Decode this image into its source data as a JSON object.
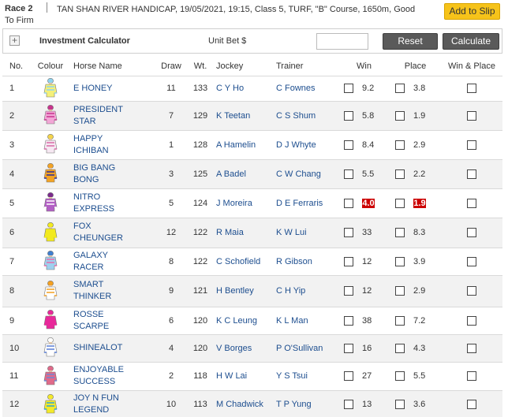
{
  "header": {
    "race_no": "Race 2",
    "race_info": "TAN SHAN RIVER HANDICAP, 19/05/2021, 19:15, Class 5, TURF, \"B\" Course, 1650m, Good To Firm",
    "add_to_slip": "Add to Slip"
  },
  "calculator": {
    "plus": "+",
    "title": "Investment Calculator",
    "unit_bet": "Unit Bet $",
    "input_value": "",
    "reset": "Reset",
    "calculate": "Calculate"
  },
  "columns": {
    "no": "No.",
    "colour": "Colour",
    "horse": "Horse Name",
    "draw": "Draw",
    "wt": "Wt.",
    "jockey": "Jockey",
    "trainer": "Trainer",
    "win": "Win",
    "place": "Place",
    "win_place": "Win & Place"
  },
  "colors": {
    "link": "#1d4e8f",
    "hot_odds": "#cc0000",
    "add_slip": "#f6c31a",
    "dark_button": "#5a5a5a"
  },
  "runners": [
    {
      "no": "1",
      "horse_l1": "E HONEY",
      "horse_l2": "",
      "draw": "11",
      "wt": "133",
      "jockey": "C Y Ho",
      "trainer": "C Fownes",
      "win": "9.2",
      "place": "3.8",
      "win_hot": false,
      "place_hot": false,
      "silk": {
        "body": "#f4f07a",
        "trim": "#8fd3ee",
        "cap": "#8fd3ee"
      }
    },
    {
      "no": "2",
      "horse_l1": "PRESIDENT",
      "horse_l2": "STAR",
      "draw": "7",
      "wt": "129",
      "jockey": "K Teetan",
      "trainer": "C S Shum",
      "win": "5.8",
      "place": "1.9",
      "win_hot": false,
      "place_hot": false,
      "silk": {
        "body": "#f2a6d6",
        "trim": "#c8338d",
        "cap": "#c8338d"
      }
    },
    {
      "no": "3",
      "horse_l1": "HAPPY",
      "horse_l2": "ICHIBAN",
      "draw": "1",
      "wt": "128",
      "jockey": "A Hamelin",
      "trainer": "D J Whyte",
      "win": "8.4",
      "place": "2.9",
      "win_hot": false,
      "place_hot": false,
      "silk": {
        "body": "#f6e8f2",
        "trim": "#d96aa8",
        "cap": "#f4d44a"
      }
    },
    {
      "no": "4",
      "horse_l1": "BIG BANG",
      "horse_l2": "BONG",
      "draw": "3",
      "wt": "125",
      "jockey": "A Badel",
      "trainer": "C W Chang",
      "win": "5.5",
      "place": "2.2",
      "win_hot": false,
      "place_hot": false,
      "silk": {
        "body": "#f3a324",
        "trim": "#2d2d9a",
        "cap": "#f3a324"
      }
    },
    {
      "no": "5",
      "horse_l1": "NITRO",
      "horse_l2": "EXPRESS",
      "draw": "5",
      "wt": "124",
      "jockey": "J Moreira",
      "trainer": "D E Ferraris",
      "win": "4.0",
      "place": "1.9",
      "win_hot": true,
      "place_hot": true,
      "silk": {
        "body": "#b25fc4",
        "trim": "#ffffff",
        "cap": "#7a2a8c"
      }
    },
    {
      "no": "6",
      "horse_l1": "FOX",
      "horse_l2": "CHEUNGER",
      "draw": "12",
      "wt": "122",
      "jockey": "R Maia",
      "trainer": "K W Lui",
      "win": "33",
      "place": "8.3",
      "win_hot": false,
      "place_hot": false,
      "silk": {
        "body": "#f2ea1e",
        "trim": "#f2ea1e",
        "cap": "#f2ea1e"
      }
    },
    {
      "no": "7",
      "horse_l1": "GALAXY",
      "horse_l2": "RACER",
      "draw": "8",
      "wt": "122",
      "jockey": "C Schofield",
      "trainer": "R Gibson",
      "win": "12",
      "place": "3.9",
      "win_hot": false,
      "place_hot": false,
      "silk": {
        "body": "#9fd0ee",
        "trim": "#e86aa8",
        "cap": "#3f7fd0"
      }
    },
    {
      "no": "8",
      "horse_l1": "SMART",
      "horse_l2": "THINKER",
      "draw": "9",
      "wt": "121",
      "jockey": "H Bentley",
      "trainer": "C H Yip",
      "win": "12",
      "place": "2.9",
      "win_hot": false,
      "place_hot": false,
      "silk": {
        "body": "#ffffff",
        "trim": "#f4a020",
        "cap": "#f4a020"
      }
    },
    {
      "no": "9",
      "horse_l1": "ROSSE",
      "horse_l2": "SCARPE",
      "draw": "6",
      "wt": "120",
      "jockey": "K C Leung",
      "trainer": "K L Man",
      "win": "38",
      "place": "7.2",
      "win_hot": false,
      "place_hot": false,
      "silk": {
        "body": "#e8289a",
        "trim": "#e8289a",
        "cap": "#e8289a"
      }
    },
    {
      "no": "10",
      "horse_l1": "SHINEALOT",
      "horse_l2": "",
      "draw": "4",
      "wt": "120",
      "jockey": "V Borges",
      "trainer": "P O'Sullivan",
      "win": "16",
      "place": "4.3",
      "win_hot": false,
      "place_hot": false,
      "silk": {
        "body": "#ffffff",
        "trim": "#5a7fd6",
        "cap": "#ffffff"
      }
    },
    {
      "no": "11",
      "horse_l1": "ENJOYABLE",
      "horse_l2": "SUCCESS",
      "draw": "2",
      "wt": "118",
      "jockey": "H W Lai",
      "trainer": "Y S Tsui",
      "win": "27",
      "place": "5.5",
      "win_hot": false,
      "place_hot": false,
      "silk": {
        "body": "#e06a8a",
        "trim": "#6a8ad6",
        "cap": "#e06a8a"
      }
    },
    {
      "no": "12",
      "horse_l1": "JOY N FUN",
      "horse_l2": "LEGEND",
      "draw": "10",
      "wt": "113",
      "jockey": "M Chadwick",
      "trainer": "T P Yung",
      "win": "13",
      "place": "3.6",
      "win_hot": false,
      "place_hot": false,
      "silk": {
        "body": "#f3e92a",
        "trim": "#2fa6d6",
        "cap": "#f3e92a"
      }
    }
  ]
}
